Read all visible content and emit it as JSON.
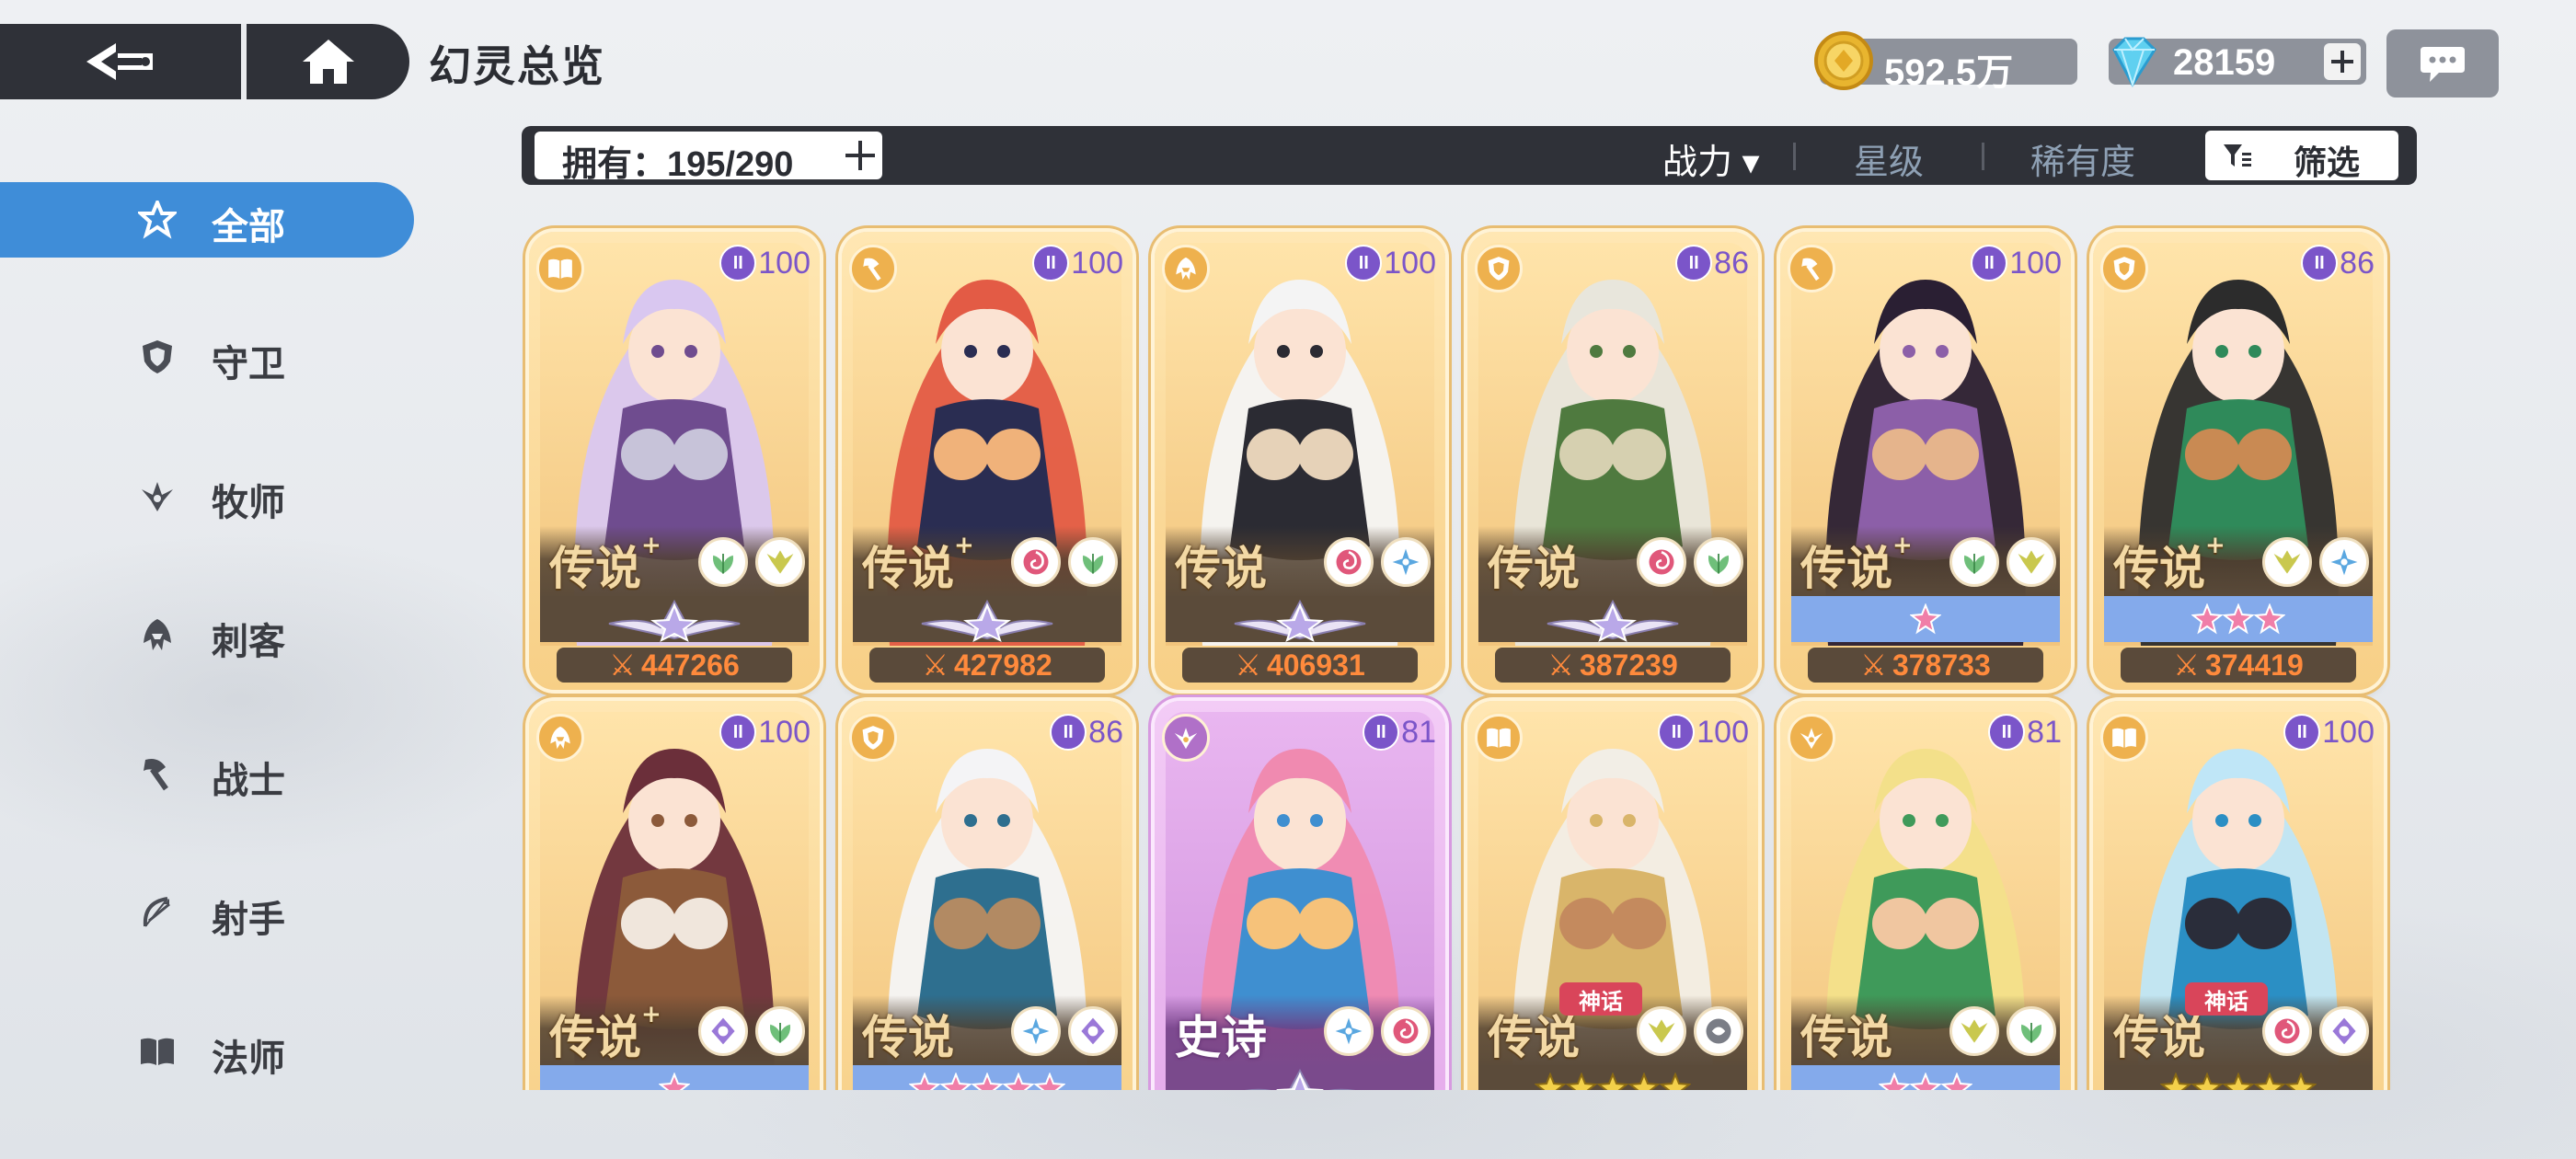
{
  "header": {
    "title": "幻灵总览",
    "back_icon": "back-arrow-icon",
    "home_icon": "home-icon",
    "gold": "592.5万",
    "gems": "28159",
    "chat_icon": "chat-bubble-icon"
  },
  "filterbar": {
    "owned_label": "拥有：195/290",
    "sort_power": "战力 ▾",
    "sort_stars": "星级",
    "sort_rarity": "稀有度",
    "filter_label": "筛选"
  },
  "sidebar": {
    "items": [
      {
        "label": "全部",
        "icon": "all-classes-icon"
      },
      {
        "label": "守卫",
        "icon": "shield-icon"
      },
      {
        "label": "牧师",
        "icon": "priest-icon"
      },
      {
        "label": "刺客",
        "icon": "assassin-icon"
      },
      {
        "label": "战士",
        "icon": "axe-icon"
      },
      {
        "label": "射手",
        "icon": "bow-icon"
      },
      {
        "label": "法师",
        "icon": "book-icon"
      }
    ]
  },
  "cards": [
    {
      "rarity": "传说",
      "plus": "+",
      "level": "100",
      "class": "book",
      "power": "447266",
      "elements": [
        "nature",
        "light"
      ],
      "stars": "3 silver",
      "palette": [
        "#d9c7f0",
        "#6f4c8f",
        "#c7c3d9"
      ]
    },
    {
      "rarity": "传说",
      "plus": "+",
      "level": "100",
      "class": "axe",
      "power": "427982",
      "elements": [
        "chaos",
        "nature"
      ],
      "stars": "3 silver",
      "palette": [
        "#e35b45",
        "#2a2d52",
        "#f0b27a"
      ]
    },
    {
      "rarity": "传说",
      "plus": "",
      "level": "100",
      "class": "assassin",
      "power": "406931",
      "elements": [
        "chaos",
        "frost"
      ],
      "stars": "3 silver",
      "palette": [
        "#f4f4f4",
        "#2b2b33",
        "#e6d2b8"
      ]
    },
    {
      "rarity": "传说",
      "plus": "",
      "level": "86",
      "class": "shield",
      "power": "387239",
      "elements": [
        "chaos",
        "nature"
      ],
      "stars": "3 silver",
      "palette": [
        "#e8e6dc",
        "#4f7a3f",
        "#d6d0b0"
      ]
    },
    {
      "rarity": "传说",
      "plus": "+",
      "level": "100",
      "class": "axe",
      "power": "378733",
      "elements": [
        "nature",
        "light"
      ],
      "stars": "1 pink",
      "palette": [
        "#2a1f33",
        "#8c5fa8",
        "#e5b48c"
      ]
    },
    {
      "rarity": "传说",
      "plus": "+",
      "level": "86",
      "class": "shield",
      "power": "374419",
      "elements": [
        "light",
        "frost"
      ],
      "stars": "3 pink",
      "palette": [
        "#2c2c2c",
        "#2f8a5a",
        "#c98a53"
      ]
    },
    {
      "rarity": "传说",
      "plus": "+",
      "level": "100",
      "class": "assassin",
      "power": "",
      "elements": [
        "void",
        "nature"
      ],
      "stars": "1 pink",
      "palette": [
        "#6b2f3a",
        "#8c5a3a",
        "#f0e6dc"
      ]
    },
    {
      "rarity": "传说",
      "plus": "",
      "level": "86",
      "class": "shield",
      "power": "",
      "elements": [
        "frost",
        "void"
      ],
      "stars": "5 pink",
      "palette": [
        "#f4f4f6",
        "#2e6f8f",
        "#b28a63"
      ]
    },
    {
      "rarity": "史诗",
      "plus": "",
      "level": "81",
      "class": "priest",
      "power": "",
      "elements": [
        "frost",
        "chaos"
      ],
      "stars": "3 silver",
      "palette": [
        "#f08ab0",
        "#3f8fd0",
        "#f6c27a"
      ]
    },
    {
      "rarity": "传说",
      "plus": "",
      "level": "100",
      "class": "book",
      "power": "",
      "myth": "神话",
      "elements": [
        "light",
        "dark"
      ],
      "stars": "5 gold",
      "palette": [
        "#f2eee6",
        "#d9b56a",
        "#c48a5e"
      ]
    },
    {
      "rarity": "传说",
      "plus": "",
      "level": "81",
      "class": "priest",
      "power": "",
      "elements": [
        "light",
        "nature"
      ],
      "stars": "3 pink",
      "palette": [
        "#f3e08a",
        "#3f9a5a",
        "#f0c6a0"
      ]
    },
    {
      "rarity": "传说",
      "plus": "",
      "level": "100",
      "class": "book",
      "power": "",
      "myth": "神话",
      "elements": [
        "chaos",
        "void"
      ],
      "stars": "5 gold",
      "palette": [
        "#bfe6f7",
        "#2b8fc4",
        "#2a2d3a"
      ]
    }
  ]
}
